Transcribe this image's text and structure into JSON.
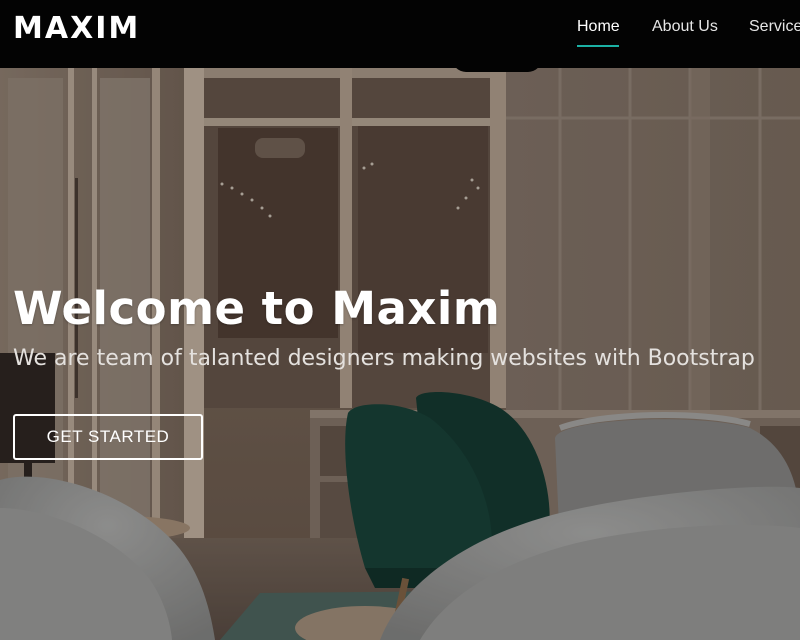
{
  "nav": {
    "logo": "MAXIM",
    "items": [
      {
        "label": "Home",
        "active": true
      },
      {
        "label": "About Us",
        "active": false
      },
      {
        "label": "Services",
        "active": false
      }
    ],
    "accent_color": "#1bb1a4"
  },
  "hero": {
    "title": "Welcome to Maxim",
    "subtitle": "We are team of talanted designers making websites with Bootstrap",
    "cta_label": "GET STARTED"
  }
}
